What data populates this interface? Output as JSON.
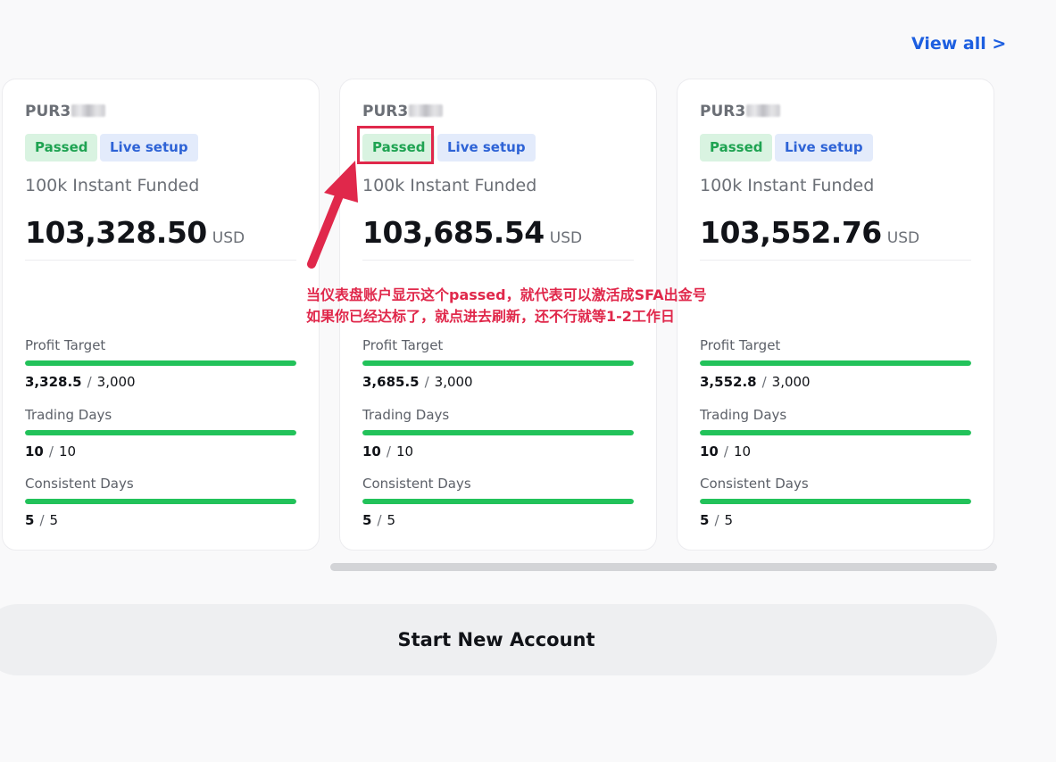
{
  "header": {
    "view_all_label": "View all >"
  },
  "cards": [
    {
      "account_id_prefix": "PUR3",
      "badges": {
        "passed": "Passed",
        "live": "Live setup"
      },
      "plan": "100k Instant Funded",
      "balance": "103,328.50",
      "currency": "USD",
      "metrics": [
        {
          "label": "Profit Target",
          "current": "3,328.5",
          "target": "3,000",
          "progress": 1.0
        },
        {
          "label": "Trading Days",
          "current": "10",
          "target": "10",
          "progress": 1.0
        },
        {
          "label": "Consistent Days",
          "current": "5",
          "target": "5",
          "progress": 1.0
        }
      ]
    },
    {
      "account_id_prefix": "PUR3",
      "badges": {
        "passed": "Passed",
        "live": "Live setup"
      },
      "plan": "100k Instant Funded",
      "balance": "103,685.54",
      "currency": "USD",
      "metrics": [
        {
          "label": "Profit Target",
          "current": "3,685.5",
          "target": "3,000",
          "progress": 1.0
        },
        {
          "label": "Trading Days",
          "current": "10",
          "target": "10",
          "progress": 1.0
        },
        {
          "label": "Consistent Days",
          "current": "5",
          "target": "5",
          "progress": 1.0
        }
      ]
    },
    {
      "account_id_prefix": "PUR3",
      "badges": {
        "passed": "Passed",
        "live": "Live setup"
      },
      "plan": "100k Instant Funded",
      "balance": "103,552.76",
      "currency": "USD",
      "metrics": [
        {
          "label": "Profit Target",
          "current": "3,552.8",
          "target": "3,000",
          "progress": 1.0
        },
        {
          "label": "Trading Days",
          "current": "10",
          "target": "10",
          "progress": 1.0
        },
        {
          "label": "Consistent Days",
          "current": "5",
          "target": "5",
          "progress": 1.0
        }
      ]
    }
  ],
  "separator": "/",
  "start_button_label": "Start New Account",
  "annotation": {
    "line1": "当仪表盘账户显示这个passed，就代表可以激活成SFA出金号",
    "line2": "如果你已经达标了，就点进去刷新，还不行就等1-2工作日",
    "color": "#e0284b"
  },
  "colors": {
    "accent_link": "#1d5fe0",
    "passed_text": "#1fa352",
    "passed_bg": "#d9f3e1",
    "live_text": "#2e63d6",
    "live_bg": "#e3ebfb",
    "progress_fill": "#22c25a"
  }
}
